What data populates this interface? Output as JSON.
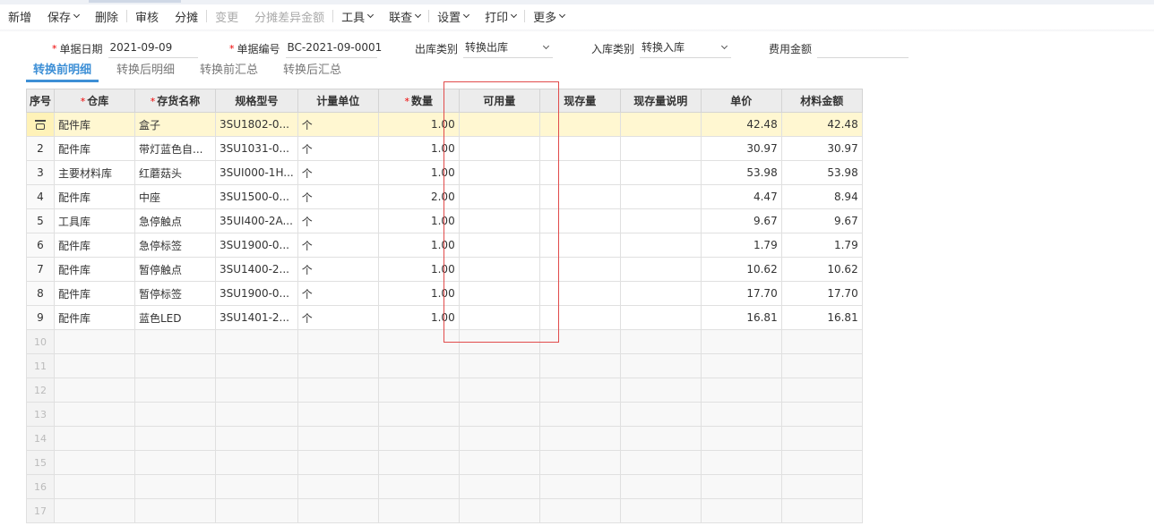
{
  "toolbar": {
    "items": [
      {
        "label": "新增",
        "caret": false,
        "disabled": false
      },
      {
        "label": "保存",
        "caret": true,
        "disabled": false
      },
      {
        "label": "删除",
        "caret": false,
        "disabled": false
      },
      {
        "label": "审核",
        "caret": false,
        "disabled": false
      },
      {
        "label": "分摊",
        "caret": false,
        "disabled": false
      },
      {
        "label": "变更",
        "caret": false,
        "disabled": true
      },
      {
        "label": "分摊差异金额",
        "caret": false,
        "disabled": true
      },
      {
        "label": "工具",
        "caret": true,
        "disabled": false
      },
      {
        "label": "联查",
        "caret": true,
        "disabled": false
      },
      {
        "label": "设置",
        "caret": true,
        "disabled": false
      },
      {
        "label": "打印",
        "caret": true,
        "disabled": false
      },
      {
        "label": "更多",
        "caret": true,
        "disabled": false
      }
    ]
  },
  "form": {
    "doc_date_label": "单据日期",
    "doc_date_value": "2021-09-09",
    "doc_no_label": "单据编号",
    "doc_no_value": "BC-2021-09-0001",
    "out_type_label": "出库类别",
    "out_type_value": "转换出库",
    "in_type_label": "入库类别",
    "in_type_value": "转换入库",
    "fee_label": "费用金额",
    "fee_value": ""
  },
  "tabs": [
    {
      "label": "转换前明细",
      "active": true
    },
    {
      "label": "转换后明细",
      "active": false
    },
    {
      "label": "转换前汇总",
      "active": false
    },
    {
      "label": "转换后汇总",
      "active": false
    }
  ],
  "grid": {
    "columns": [
      {
        "key": "seq",
        "label": "序号",
        "required": false
      },
      {
        "key": "warehouse",
        "label": "仓库",
        "required": true
      },
      {
        "key": "item",
        "label": "存货名称",
        "required": true
      },
      {
        "key": "spec",
        "label": "规格型号",
        "required": false
      },
      {
        "key": "unit",
        "label": "计量单位",
        "required": false
      },
      {
        "key": "qty",
        "label": "数量",
        "required": true
      },
      {
        "key": "avail",
        "label": "可用量",
        "required": false
      },
      {
        "key": "stock",
        "label": "现存量",
        "required": false
      },
      {
        "key": "stock_note",
        "label": "现存量说明",
        "required": false
      },
      {
        "key": "price",
        "label": "单价",
        "required": false
      },
      {
        "key": "amount",
        "label": "材料金额",
        "required": false
      }
    ],
    "rows": [
      {
        "seq": "",
        "warehouse": "配件库",
        "item": "盒子",
        "spec": "3SU1802-0...",
        "unit": "个",
        "qty": "1.00",
        "avail": "",
        "stock": "",
        "stock_note": "",
        "price": "42.48",
        "amount": "42.48"
      },
      {
        "seq": "2",
        "warehouse": "配件库",
        "item": "带灯蓝色自...",
        "spec": "3SU1031-0...",
        "unit": "个",
        "qty": "1.00",
        "avail": "",
        "stock": "",
        "stock_note": "",
        "price": "30.97",
        "amount": "30.97"
      },
      {
        "seq": "3",
        "warehouse": "主要材料库",
        "item": "红蘑菇头",
        "spec": "3SUI000-1H...",
        "unit": "个",
        "qty": "1.00",
        "avail": "",
        "stock": "",
        "stock_note": "",
        "price": "53.98",
        "amount": "53.98"
      },
      {
        "seq": "4",
        "warehouse": "配件库",
        "item": "中座",
        "spec": "3SU1500-0...",
        "unit": "个",
        "qty": "2.00",
        "avail": "",
        "stock": "",
        "stock_note": "",
        "price": "4.47",
        "amount": "8.94"
      },
      {
        "seq": "5",
        "warehouse": "工具库",
        "item": "急停触点",
        "spec": "35UI400-2A...",
        "unit": "个",
        "qty": "1.00",
        "avail": "",
        "stock": "",
        "stock_note": "",
        "price": "9.67",
        "amount": "9.67"
      },
      {
        "seq": "6",
        "warehouse": "配件库",
        "item": "急停标签",
        "spec": "3SU1900-0...",
        "unit": "个",
        "qty": "1.00",
        "avail": "",
        "stock": "",
        "stock_note": "",
        "price": "1.79",
        "amount": "1.79"
      },
      {
        "seq": "7",
        "warehouse": "配件库",
        "item": "暂停触点",
        "spec": "3SU1400-2...",
        "unit": "个",
        "qty": "1.00",
        "avail": "",
        "stock": "",
        "stock_note": "",
        "price": "10.62",
        "amount": "10.62"
      },
      {
        "seq": "8",
        "warehouse": "配件库",
        "item": "暂停标签",
        "spec": "3SU1900-0...",
        "unit": "个",
        "qty": "1.00",
        "avail": "",
        "stock": "",
        "stock_note": "",
        "price": "17.70",
        "amount": "17.70"
      },
      {
        "seq": "9",
        "warehouse": "配件库",
        "item": "蓝色LED",
        "spec": "3SU1401-2...",
        "unit": "个",
        "qty": "1.00",
        "avail": "",
        "stock": "",
        "stock_note": "",
        "price": "16.81",
        "amount": "16.81"
      }
    ],
    "empty_rows": [
      "10",
      "11",
      "12",
      "13",
      "14",
      "15",
      "16",
      "17"
    ]
  }
}
